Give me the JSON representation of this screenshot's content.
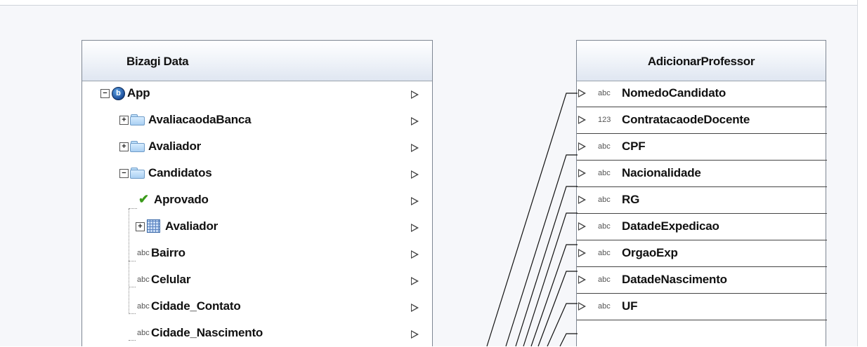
{
  "left_panel": {
    "title": "Bizagi Data",
    "items": [
      {
        "label": "App",
        "type": "entity-root",
        "expander": "−"
      },
      {
        "label": "AvaliacaodaBanca",
        "type": "entity",
        "expander": "+"
      },
      {
        "label": "Avaliador",
        "type": "entity",
        "expander": "+"
      },
      {
        "label": "Candidatos",
        "type": "entity",
        "expander": "−"
      },
      {
        "label": "Aprovado",
        "type": "boolean"
      },
      {
        "label": "Avaliador",
        "type": "collection",
        "expander": "+"
      },
      {
        "label": "Bairro",
        "type": "string",
        "type_label": "abc"
      },
      {
        "label": "Celular",
        "type": "string",
        "type_label": "abc"
      },
      {
        "label": "Cidade_Contato",
        "type": "string",
        "type_label": "abc"
      },
      {
        "label": "Cidade_Nascimento",
        "type": "string",
        "type_label": "abc"
      }
    ]
  },
  "right_panel": {
    "title": "AdicionarProfessor",
    "items": [
      {
        "label": "NomedoCandidato",
        "type_label": "abc"
      },
      {
        "label": "ContratacaodeDocente",
        "type_label": "123"
      },
      {
        "label": "CPF",
        "type_label": "abc"
      },
      {
        "label": "Nacionalidade",
        "type_label": "abc"
      },
      {
        "label": "RG",
        "type_label": "abc"
      },
      {
        "label": "DatadeExpedicao",
        "type_label": "abc"
      },
      {
        "label": "OrgaoExp",
        "type_label": "abc"
      },
      {
        "label": "DatadeNascimento",
        "type_label": "abc"
      },
      {
        "label": "UF",
        "type_label": "abc"
      }
    ]
  },
  "icons": {
    "root": "bizagi-b-icon",
    "entity": "folder-icon",
    "boolean": "checkmark-icon",
    "collection": "grid-icon",
    "port": "triangle-port-icon"
  },
  "colors": {
    "canvas": "#f6f7fa",
    "header_gradient_end": "#dfe6f1",
    "line": "#111111"
  }
}
